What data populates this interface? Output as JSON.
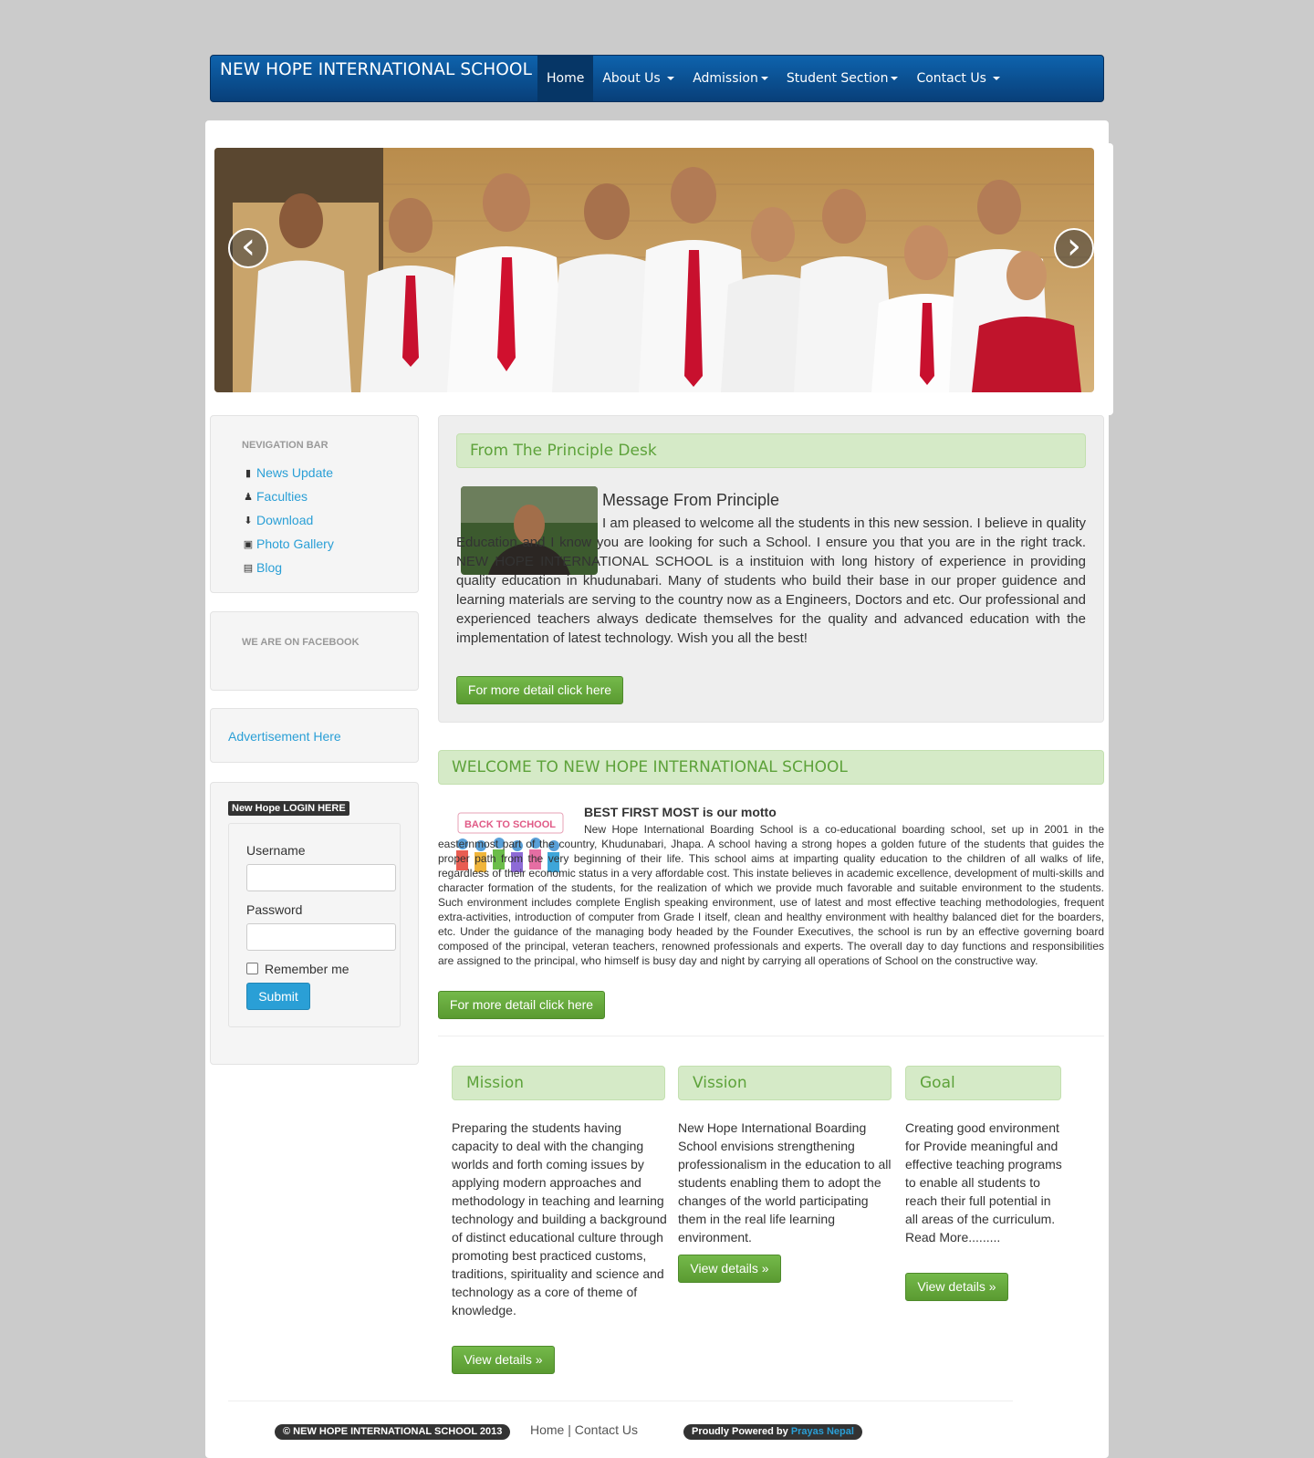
{
  "navbar": {
    "brand": "NEW HOPE INTERNATIONAL SCHOOL",
    "items": [
      {
        "label": "Home",
        "active": true,
        "dropdown": false
      },
      {
        "label": "About Us",
        "active": false,
        "dropdown": true
      },
      {
        "label": "Admission",
        "active": false,
        "dropdown": true
      },
      {
        "label": "Student Section",
        "active": false,
        "dropdown": true
      },
      {
        "label": "Contact Us",
        "active": false,
        "dropdown": true
      }
    ]
  },
  "carousel": {
    "prev": "‹",
    "next": "›"
  },
  "sidebar": {
    "nav_header": "NEVIGATION BAR",
    "links": [
      {
        "label": "News Update",
        "icon": "book-icon"
      },
      {
        "label": "Faculties",
        "icon": "user-icon"
      },
      {
        "label": "Download",
        "icon": "download-icon"
      },
      {
        "label": "Photo Gallery",
        "icon": "picture-icon"
      },
      {
        "label": "Blog",
        "icon": "list-icon"
      }
    ],
    "facebook_header": "WE ARE ON FACEBOOK",
    "advertisement": "Advertisement Here",
    "login": {
      "badge": "New Hope LOGIN HERE",
      "username_label": "Username",
      "password_label": "Password",
      "remember": "Remember me",
      "submit": "Submit"
    }
  },
  "principal": {
    "bar_title": "From The Principle Desk",
    "heading": "Message From Principle",
    "text": "I am pleased to welcome all the students in this new session. I believe in quality Education and I know you are looking for such a School. I ensure you that you are in the right track. NEW HOPE INTERNATIONAL SCHOOL is a instituion with long history of experience in providing quality education in khudunabari. Many of students who build their base in our proper guidence and learning materials are serving to the country now as a Engineers, Doctors and etc. Our professional and experienced teachers always dedicate themselves for the quality and advanced education with the implementation of latest technology. Wish you all the best!",
    "button": "For more detail click here"
  },
  "welcome": {
    "bar_title": "WELCOME TO NEW HOPE INTERNATIONAL SCHOOL",
    "image_text": "BACK TO SCHOOL",
    "motto": "BEST FIRST MOST is our motto",
    "text": "New Hope International Boarding School is a co-educational boarding school, set up in 2001 in the easternmost part of the country, Khudunabari, Jhapa. A school having a strong hopes a golden future of the students that guides the proper path from the very beginning of their life. This school aims at imparting quality education to the children of all walks of life, regardless of their economic status in a very affordable cost. This instate believes in academic excellence, development of multi-skills and character formation of the students, for the realization of which we provide much favorable and suitable environment to the students. Such environment includes complete English speaking environment, use of latest and most effective teaching methodologies, frequent extra-activities, introduction of computer from Grade I itself, clean and healthy environment with healthy balanced diet for the boarders, etc. Under the guidance of the managing body headed by the Founder Executives, the school is run by an effective governing board composed of the principal, veteran teachers, renowned professionals and experts. The overall day to day functions and responsibilities are assigned to the principal, who himself is busy day and night by carrying all operations of School on the constructive way.",
    "button": "For more detail click here"
  },
  "columns": [
    {
      "title": "Mission",
      "text": "Preparing the students having capacity to deal with the changing worlds and forth coming issues by applying modern approaches and methodology in teaching and learning technology and building a background of distinct educational culture through promoting best practiced customs, traditions, spirituality and science and technology as a core of theme of knowledge.",
      "button": "View details »"
    },
    {
      "title": "Vission",
      "text": "New Hope International Boarding School envisions strengthening professionalism in the education to all students enabling them to adopt the changes of the world participating them in the real life learning environment.",
      "button": "View details »"
    },
    {
      "title": "Goal",
      "text": "Creating good environment for Provide meaningful and effective teaching programs to enable all students to reach their full potential in all areas of the curriculum. Read More.........",
      "button": "View details »"
    }
  ],
  "footer": {
    "copyright": "© NEW HOPE INTERNATIONAL SCHOOL 2013",
    "home": "Home",
    "sep": "|",
    "contact": "Contact Us",
    "powered": "Proudly Powered by",
    "powered_by": "Prayas Nepal"
  },
  "colors": {
    "nav": "#0a5296",
    "link": "#2a9fd6",
    "green_bar": "#d5eac7",
    "green_text": "#5da23a",
    "button_green": "#62a63a"
  }
}
